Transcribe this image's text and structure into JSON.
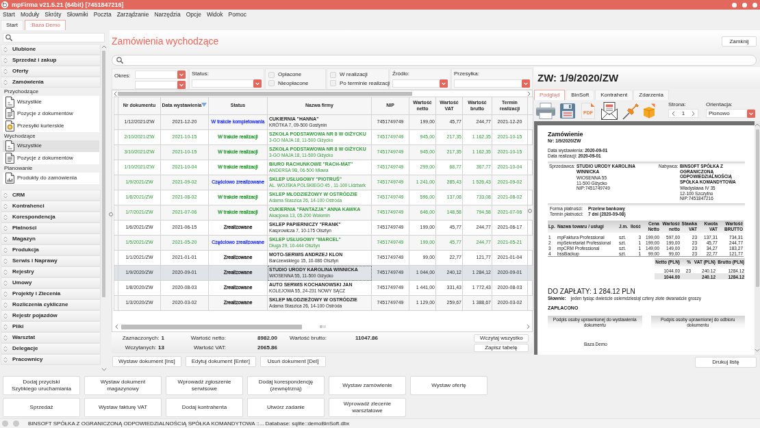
{
  "window": {
    "title": "mpFirma v21.5.21 (64bit) [7451847216]"
  },
  "menu": [
    "Start",
    "Moduły",
    "Skróty",
    "Słowniki",
    "Poczta",
    "Zarządzanie",
    "Narzędzia",
    "Opcje",
    "Widok",
    "Pomoc"
  ],
  "tabs": [
    {
      "label": "Start",
      "selected": false
    },
    {
      "label": ":Baza Demo",
      "selected": true
    }
  ],
  "sidebar": {
    "sections": [
      {
        "label": "Ulubione"
      },
      {
        "label": "Sprzedaż i zakup"
      },
      {
        "label": "Oferty"
      },
      {
        "label": "Zamówienia",
        "groups": [
          {
            "label": "Przychodzące",
            "items": [
              {
                "label": "Wszystkie",
                "kind": "document",
                "selected": false
              },
              {
                "label": "Pozycje z dokumentów",
                "kind": "list",
                "selected": false
              },
              {
                "label": "Przesyłki kurierskie",
                "kind": "parcel",
                "selected": false
              }
            ]
          },
          {
            "label": "Wychodzące",
            "items": [
              {
                "label": "Wszystkie",
                "kind": "document",
                "selected": true
              },
              {
                "label": "Pozycje z dokumentów",
                "kind": "list",
                "selected": false
              }
            ]
          },
          {
            "label": "Planowanie",
            "items": [
              {
                "label": "Produkty do zamówienia",
                "kind": "chart",
                "selected": false
              }
            ]
          }
        ]
      },
      {
        "label": "CRM"
      },
      {
        "label": "Kontrahenci"
      },
      {
        "label": "Korespondencja"
      },
      {
        "label": "Płatności"
      },
      {
        "label": "Magazyn"
      },
      {
        "label": "Produkcja"
      },
      {
        "label": "Serwis i Naprawy"
      },
      {
        "label": "Rejestry"
      },
      {
        "label": "Umowy"
      },
      {
        "label": "Projekty i Zlecenia"
      },
      {
        "label": "Rozliczenia cykliczne"
      },
      {
        "label": "Rejestr pojazdów"
      },
      {
        "label": "Pliki"
      },
      {
        "label": "Warsztat"
      },
      {
        "label": "Delegacje"
      },
      {
        "label": "Pracownicy"
      }
    ]
  },
  "page": {
    "title": "Zamówienia wychodzące",
    "close_button": "Zamknij"
  },
  "filters": {
    "period_label": "Okres:",
    "status_label": "Status:",
    "checks": [
      {
        "label": "Opłacone",
        "checked": false
      },
      {
        "label": "Nieopłacone",
        "checked": false
      },
      {
        "label": "W realizacji",
        "checked": false
      },
      {
        "label": "Po terminie realizacji",
        "checked": false
      }
    ],
    "source_label": "Źródło:",
    "shipment_label": "Przesyłka:"
  },
  "table": {
    "columns": [
      {
        "label": "Nr dokumentu",
        "sorted": false
      },
      {
        "label": "Data wystawienia",
        "sorted": true
      },
      {
        "label": "Status",
        "sorted": false
      },
      {
        "label": "Nazwa firmy",
        "sorted": false
      },
      {
        "label": "NIP",
        "sorted": false
      },
      {
        "label": "Wartość\nnetto",
        "sorted": false
      },
      {
        "label": "Wartość\nVAT",
        "sorted": false
      },
      {
        "label": "Wartość\nbrutto",
        "sorted": false
      },
      {
        "label": "Termin\nrealizacji",
        "sorted": false
      }
    ],
    "rows": [
      {
        "number": "1/12/2021/ZW",
        "date": "2021-12-20",
        "status": {
          "label": "W trakcie kompletowania",
          "color": "#2f3fee"
        },
        "company": "CUKIERNIA \"HANNA\"",
        "address": "KRÓTKA 7, 09-500 Gostynin",
        "nip": "7451749749",
        "net": "199,00",
        "vat": "45,77",
        "gross": "244,77",
        "due": "2021-12-20",
        "color": "#1e1e1e",
        "selected": false
      },
      {
        "number": "2/10/2021/ZW",
        "date": "2021-10-15",
        "status": {
          "label": "W trakcie realizacji",
          "color": "#2e9a36"
        },
        "company": "SZKOŁA PODSTAWOWA NR 8 W GIŻYCKU",
        "address": "3-GO MAJA 18, 11-500 Giżycko",
        "nip": "7451749749",
        "net": "945,00",
        "vat": "217,35",
        "gross": "1 162,35",
        "due": "2021-10-15",
        "color": "#2e9a36",
        "selected": false
      },
      {
        "number": "3/10/2021/ZW",
        "date": "2021-10-15",
        "status": {
          "label": "W trakcie realizacji",
          "color": "#2e9a36"
        },
        "company": "SZKOŁA PODSTAWOWA NR 8 W GIŻYCKU",
        "address": "3-GO MAJA 18, 11-500 Giżycko",
        "nip": "7451749749",
        "net": "945,00",
        "vat": "217,35",
        "gross": "1 162,35",
        "due": "2021-10-15",
        "color": "#2e9a36",
        "selected": false
      },
      {
        "number": "1/10/2021/ZW",
        "date": "2021-10-04",
        "status": {
          "label": "W trakcie realizacji",
          "color": "#2e9a36"
        },
        "company": "BIURO RACHUNKOWE \"RACH-MAT\"",
        "address": "ANDERSA 9B, 06-500 Mława",
        "nip": "7451749749",
        "net": "299,00",
        "vat": "68,77",
        "gross": "367,77",
        "due": "2021-10-04",
        "color": "#2e9a36",
        "selected": false
      },
      {
        "number": "1/9/2021/ZW",
        "date": "2021-09-02",
        "status": {
          "label": "Częściowo zrealizowane",
          "color": "#2f3fee"
        },
        "company": "SKLEP USŁUGOWY \"PIOTRUŚ\"",
        "address": "AL. WOJSKA POLSKIEGO 45 , 11-100 Lidzbark",
        "nip": "7451749749",
        "net": "1 241,00",
        "vat": "285,43",
        "gross": "1 526,43",
        "due": "2021-09-02",
        "color": "#2e9a36",
        "selected": false
      },
      {
        "number": "1/8/2021/ZW",
        "date": "2021-08-02",
        "status": {
          "label": "W trakcie realizacji",
          "color": "#2e9a36"
        },
        "company": "SKLEP MŁODZIEŻOWY W OSTRÓDZIE",
        "address": "Adama Staszica 26, 14-100 Ostróda",
        "nip": "7451749749",
        "net": "596,00",
        "vat": "137,08",
        "gross": "733,08",
        "due": "2021-08-02",
        "color": "#2e9a36",
        "selected": false
      },
      {
        "number": "1/7/2021/ZW",
        "date": "2021-07-06",
        "status": {
          "label": "W trakcie realizacji",
          "color": "#2e9a36"
        },
        "company": "CUKIERNIA \"FANTAZJA\" ANNA KAWKA",
        "address": "Akacjowa 13, 05-200 Wołomin",
        "nip": "7451749749",
        "net": "646,00",
        "vat": "148,58",
        "gross": "794,58",
        "due": "2021-07-06",
        "color": "#2e9a36",
        "selected": false
      },
      {
        "number": "1/6/2021/ZW",
        "date": "2021-06-15",
        "status": {
          "label": "Zrealizowane",
          "color": "#1e1e1e"
        },
        "company": "SKLEP PAPIERNICZY \"FRANK\"",
        "address": "Kasprowicza 7, 10-175 Olsztyn",
        "nip": "7451749749",
        "net": "199,00",
        "vat": "45,77",
        "gross": "244,77",
        "due": "2021-06-17",
        "color": "#1e1e1e",
        "selected": false
      },
      {
        "number": "1/5/2021/ZW",
        "date": "2021-05-20",
        "status": {
          "label": "Częściowo zrealizowane",
          "color": "#2f3fee"
        },
        "company": "SKLEP USŁUGOWY \"MARCEL\"",
        "address": "Długa 29, 10-444 Olsztyn",
        "nip": "7451749749",
        "net": "199,00",
        "vat": "45,77",
        "gross": "244,77",
        "due": "2021-05-21",
        "color": "#2e9a36",
        "selected": false
      },
      {
        "number": "1/1/2021/ZW",
        "date": "2021-01-01",
        "status": {
          "label": "Zrealizowane",
          "color": "#1e1e1e"
        },
        "company": "MOTO-SERWIS ANDRZEJ KLON",
        "address": "Barczewskiego 15, 10-086 Olsztyn",
        "nip": "7451749749",
        "net": "99,00",
        "vat": "22,77",
        "gross": "121,77",
        "due": "2021-01-04",
        "color": "#1e1e1e",
        "selected": false
      },
      {
        "number": "1/9/2020/ZW",
        "date": "2020-09-01",
        "status": {
          "label": "Zrealizowane",
          "color": "#1e1e1e"
        },
        "company": "STUDIO URODY KAROLINA WINNICKA",
        "address": "WIOSENNA 55, 11-500 Giżycko",
        "nip": "7451749749",
        "net": "1 044,00",
        "vat": "240,12",
        "gross": "1 284,12",
        "due": "2020-09-01",
        "color": "#1e1e1e",
        "selected": true
      },
      {
        "number": "1/8/2020/ZW",
        "date": "2020-08-03",
        "status": {
          "label": "Zrealizowane",
          "color": "#1e1e1e"
        },
        "company": "AUTO SERWIS KOCHANOWSKI JAN",
        "address": "KOLEJOWA 55, 24-231 NOWY SĄCZ",
        "nip": "7451749749",
        "net": "1 441,00",
        "vat": "331,43",
        "gross": "1 772,43",
        "due": "2020-08-03",
        "color": "#1e1e1e",
        "selected": false
      },
      {
        "number": "1/3/2020/ZW",
        "date": "2020-03-02",
        "status": {
          "label": "Zrealizowane",
          "color": "#1e1e1e"
        },
        "company": "SKLEP MŁODZIEŻOWY W OSTRÓDZIE",
        "address": "Adama Staszica 26, 14-100 Ostróda",
        "nip": "7451749749",
        "net": "1 129,00",
        "vat": "259,67",
        "gross": "1 388,67",
        "due": "2020-03-02",
        "color": "#1e1e1e",
        "selected": false
      }
    ]
  },
  "summary": {
    "selected": {
      "label": "Zaznaczonych:",
      "value": "1"
    },
    "loaded": {
      "label": "Wczytanych:",
      "value": "13"
    },
    "net": {
      "label": "Wartość netto:",
      "value": "8982.00"
    },
    "vat": {
      "label": "Wartość VAT:",
      "value": "2065.86"
    },
    "gross": {
      "label": "Wartość brutto:",
      "value": "11047.86"
    },
    "buttons": [
      "Wczytaj wszystko",
      "Zapisz tabelę"
    ]
  },
  "actions": [
    "Wystaw dokument [Ins]",
    "Edytuj dokument [Enter]",
    "Usuń dokument [Del]"
  ],
  "detail": {
    "title": "ZW: 1/9/2020/ZW",
    "tabs": [
      {
        "label": "Podgląd",
        "selected": true
      },
      {
        "label": "BinSoft",
        "selected": false
      },
      {
        "label": "Kontrahent",
        "selected": false
      },
      {
        "label": "Zdarzenia",
        "selected": false
      }
    ],
    "toolbar": {
      "pdf_label": "PDF",
      "page_label": "Strona:",
      "page_value": "1",
      "orientation_label": "Orientacja:",
      "orientation_value": "Pionowo"
    },
    "document": {
      "title": "Zamówienie",
      "number": "Nr: 1/9/2020/ZW",
      "dates": [
        "Data wystawienia: **2020-09-01**",
        "Data realizacji: **2020-09-01**"
      ],
      "seller": {
        "label": "Sprzedawca:",
        "name": "STUDIO URODY KAROLINA WINNICKA",
        "lines": [
          "WIOSENNA 55",
          "11-500 Giżycko",
          "NIP:7451749749"
        ]
      },
      "buyer": {
        "label": "Nabywca:",
        "name": "BINSOFT SPÓŁKA Z OGRANICZONĄ ODPOWIEDZIALNOŚCIĄ SPÓŁKA KOMANDYTOWA",
        "lines": [
          "Władysława IV 35",
          "12-100 Szczytno",
          "NIP:7451847216"
        ]
      },
      "payment": [
        {
          "label": "Forma płatności:",
          "value": "Przelew bankowy"
        },
        {
          "label": "Termin płatności:",
          "value": "7 dni (2020-09-08)"
        }
      ],
      "items": {
        "columns": [
          "Lp.",
          "Nazwa towaru / usługi",
          "J.m.",
          "Ilość",
          "Cena\nNetto",
          "Wartość\nnetto",
          "Stawka\nVAT",
          "Kwota\nVAT",
          "Wartość\nBRUTTO"
        ],
        "rows": [
          [
            "1",
            "mpFaktura Professional",
            "szt.",
            "3",
            "199,00",
            "597,00",
            "23",
            "137,31",
            "734,31"
          ],
          [
            "2",
            "mpSekretariat Professional",
            "szt.",
            "1",
            "199,00",
            "199,00",
            "23",
            "45,77",
            "244,77"
          ],
          [
            "3",
            "mpCRM Professional",
            "szt.",
            "1",
            "149,00",
            "149,00",
            "23",
            "34,27",
            "183,27"
          ],
          [
            "4",
            "bssBackup",
            "szt.",
            "1",
            "99,00",
            "99,00",
            "23",
            "22,77",
            "121,77"
          ]
        ]
      },
      "totals": {
        "columns": [
          "Netto (PLN)",
          "%",
          "VAT (PLN)",
          "Brutto (PLN)"
        ],
        "rows": [
          {
            "kind": "rate",
            "net": "1044.00",
            "rate": "23",
            "vat": "240.12",
            "gross": "1284.12"
          },
          {
            "kind": "sum",
            "net": "1044.00",
            "vat": "240.12",
            "gross": "1284.12"
          }
        ]
      },
      "amount_due": "DO ZAPŁATY: 1 284.12 PLN",
      "in_words_label": "Słownie:",
      "in_words": "jeden tysiąc dwieście osiemdziesiąt cztery złote dwanaście groszy",
      "paid": "ZAPŁACONO",
      "signatures": [
        "Podpis osoby uprawnionej do wystawienia dokumentu",
        "Podpis osoby uprawnionej do odbioru dokumentu"
      ],
      "footer": "Baza Demo"
    },
    "print_button": "Drukuj listę"
  },
  "quick_buttons": [
    "Dodaj przyciski\nSzybkiego uruchamiania",
    "Wystaw dokument\nmagazynowy",
    "Wprowadź zgłoszenie\nserwisowe",
    "Dodaj korespondencję\n(zewnętrzną)",
    "Wystaw zamówienie",
    "Wystaw ofertę",
    "Sprzedaż",
    "Wystaw fakturę VAT",
    "Dodaj kontrahenta",
    "Utwórz zadanie",
    "Wprowadź zlecenie\nwarsztatowe"
  ],
  "status_bar": {
    "text": "BINSOFT SPÓŁKA Z OGRANICZONĄ ODPOWIEDZIALNOŚCIĄ SPÓŁKA KOMANDYTOWA ::... Database: sqlite::demoBinSoft.dbx"
  }
}
